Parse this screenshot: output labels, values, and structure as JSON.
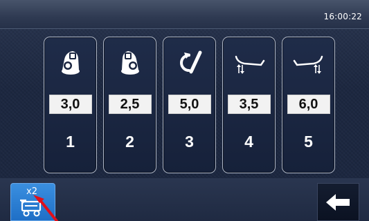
{
  "status_bar": {
    "time": "16:00:22"
  },
  "programs": [
    {
      "value": "3,0",
      "number": "1",
      "icon": "weight-tilt-left-icon"
    },
    {
      "value": "2,5",
      "number": "2",
      "icon": "weight-tilt-right-icon"
    },
    {
      "value": "5,0",
      "number": "3",
      "icon": "rotation-slash-icon"
    },
    {
      "value": "3,5",
      "number": "4",
      "icon": "curve-left-arrows-icon"
    },
    {
      "value": "6,0",
      "number": "5",
      "icon": "curve-right-arrows-icon"
    }
  ],
  "footer": {
    "multiplier_label": "x2",
    "multiplier_icon": "vehicle-icon",
    "back_icon": "arrow-left-icon"
  },
  "colors": {
    "accent_blue": "#2a7fd6",
    "card_border": "#aeb7c8",
    "pointer_red": "#e0101a"
  }
}
